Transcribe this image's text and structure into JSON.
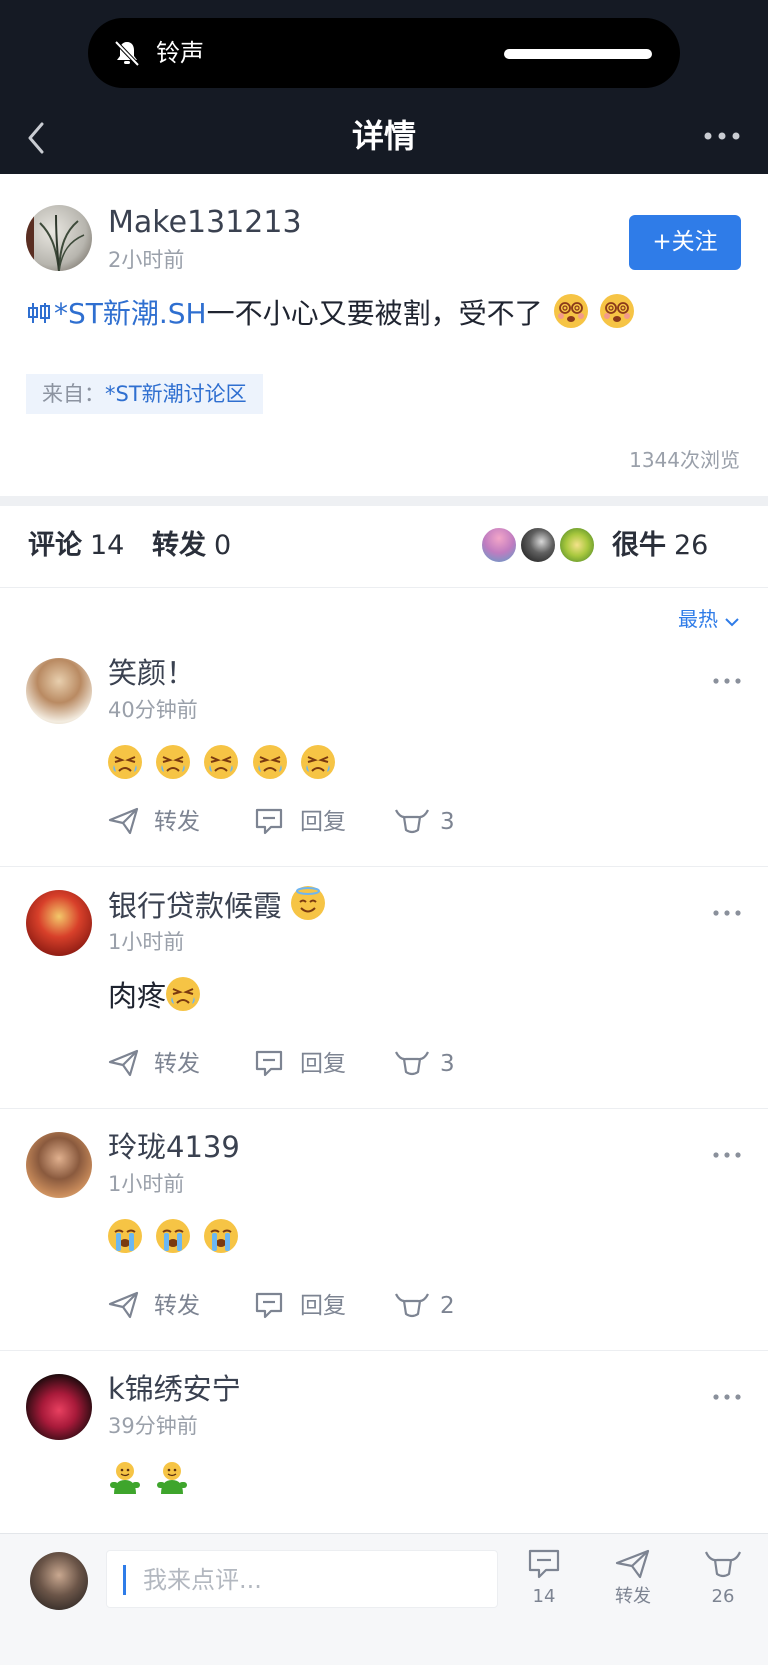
{
  "status_island": {
    "label": "铃声"
  },
  "nav": {
    "title": "详情"
  },
  "post": {
    "author": "Make131213",
    "time": "2小时前",
    "follow_label": "+关注",
    "stock_tag": "*ST新潮.SH",
    "text": "一不小心又要被割，受不了",
    "from_prefix": "来自：",
    "from_name": "*ST新潮讨论区",
    "views": "1344次浏览"
  },
  "stats": {
    "comments_label": "评论",
    "comments_count": "14",
    "reposts_label": "转发",
    "reposts_count": "0",
    "likes_label": "很牛",
    "likes_count": "26"
  },
  "sort_label": "最热",
  "comments": [
    {
      "name": "笑颜！",
      "time": "40分钟前",
      "body": "",
      "emoji_count": 5,
      "emoji_type": "angry-cry",
      "repost_label": "转发",
      "reply_label": "回复",
      "likes": "3"
    },
    {
      "name": "银行贷款候霞",
      "time": "1小时前",
      "body": "肉疼",
      "emoji_count": 1,
      "emoji_type": "angry-cry",
      "repost_label": "转发",
      "reply_label": "回复",
      "likes": "3"
    },
    {
      "name": "玲珑4139",
      "time": "1小时前",
      "body": "",
      "emoji_count": 3,
      "emoji_type": "crying",
      "repost_label": "转发",
      "reply_label": "回复",
      "likes": "2"
    },
    {
      "name": "k锦绣安宁",
      "time": "39分钟前",
      "body": "",
      "emoji_count": 2,
      "emoji_type": "green-figure"
    }
  ],
  "bottom_bar": {
    "input_placeholder": "我来点评...",
    "comment_count": "14",
    "repost_label": "转发",
    "like_count": "26"
  },
  "colors": {
    "header_bg": "#151a24",
    "accent_blue": "#2f7ce8",
    "link_blue": "#2f6fd0",
    "muted_text": "#9aa0aa"
  }
}
